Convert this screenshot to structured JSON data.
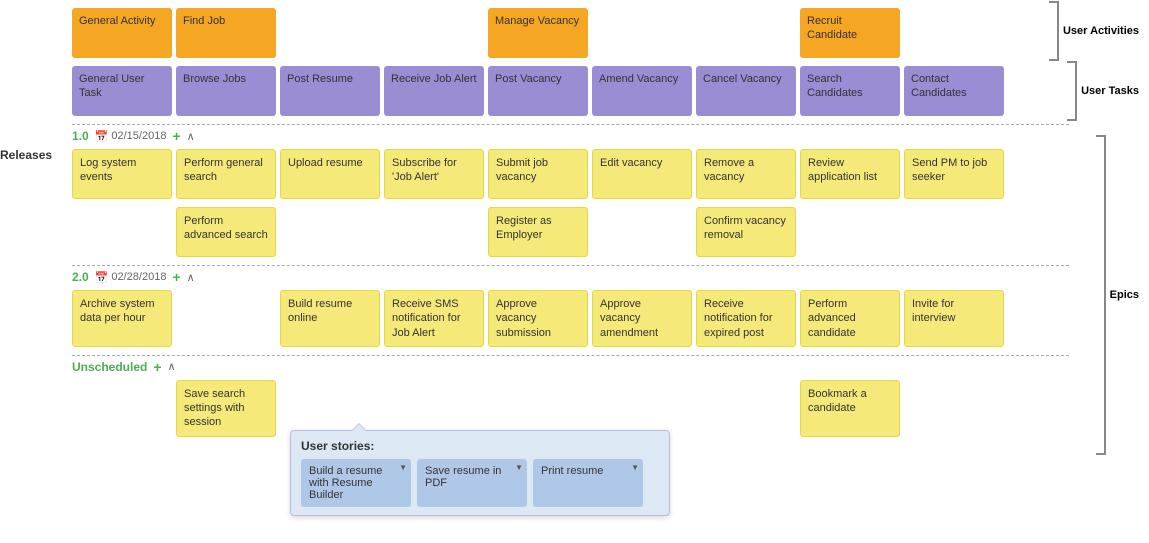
{
  "rightLabels": {
    "userActivities": "User Activities",
    "userTasks": "User Tasks",
    "epics": "Epics"
  },
  "leftLabels": {
    "releases": "Releases"
  },
  "userActivities": [
    {
      "label": "General Activity",
      "color": "orange"
    },
    {
      "label": "Find Job",
      "color": "orange"
    },
    {
      "label": "",
      "color": "empty"
    },
    {
      "label": "",
      "color": "empty"
    },
    {
      "label": "Manage Vacancy",
      "color": "orange"
    },
    {
      "label": "",
      "color": "empty"
    },
    {
      "label": "",
      "color": "empty"
    },
    {
      "label": "Recruit Candidate",
      "color": "orange"
    },
    {
      "label": "",
      "color": "empty"
    }
  ],
  "userTasks": [
    {
      "label": "General User Task",
      "color": "purple"
    },
    {
      "label": "Browse Jobs",
      "color": "purple"
    },
    {
      "label": "Post Resume",
      "color": "purple"
    },
    {
      "label": "Receive Job Alert",
      "color": "purple"
    },
    {
      "label": "Post Vacancy",
      "color": "purple"
    },
    {
      "label": "Amend Vacancy",
      "color": "purple"
    },
    {
      "label": "Cancel Vacancy",
      "color": "purple"
    },
    {
      "label": "Search Candidates",
      "color": "purple"
    },
    {
      "label": "Contact Candidates",
      "color": "purple"
    }
  ],
  "releases": [
    {
      "version": "1.0",
      "date": "02/15/2018",
      "rows": [
        [
          {
            "label": "Log system events",
            "color": "yellow"
          },
          {
            "label": "Perform general search",
            "color": "yellow"
          },
          {
            "label": "Upload resume",
            "color": "yellow"
          },
          {
            "label": "Subscribe for 'Job Alert'",
            "color": "yellow"
          },
          {
            "label": "Submit job vacancy",
            "color": "yellow"
          },
          {
            "label": "Edit vacancy",
            "color": "yellow"
          },
          {
            "label": "Remove a vacancy",
            "color": "yellow"
          },
          {
            "label": "Review application list",
            "color": "yellow"
          },
          {
            "label": "Send PM to job seeker",
            "color": "yellow"
          }
        ],
        [
          {
            "label": "",
            "color": "empty"
          },
          {
            "label": "Perform advanced search",
            "color": "yellow"
          },
          {
            "label": "",
            "color": "empty"
          },
          {
            "label": "",
            "color": "empty"
          },
          {
            "label": "Register as Employer",
            "color": "yellow"
          },
          {
            "label": "",
            "color": "empty"
          },
          {
            "label": "Confirm vacancy removal",
            "color": "yellow"
          },
          {
            "label": "",
            "color": "empty"
          },
          {
            "label": "",
            "color": "empty"
          }
        ]
      ]
    },
    {
      "version": "2.0",
      "date": "02/28/2018",
      "rows": [
        [
          {
            "label": "Archive system data per hour",
            "color": "yellow"
          },
          {
            "label": "",
            "color": "empty"
          },
          {
            "label": "Build resume online",
            "color": "yellow"
          },
          {
            "label": "Receive SMS notification for Job Alert",
            "color": "yellow"
          },
          {
            "label": "Approve vacancy submission",
            "color": "yellow"
          },
          {
            "label": "Approve vacancy amendment",
            "color": "yellow"
          },
          {
            "label": "Receive notification for expired post",
            "color": "yellow"
          },
          {
            "label": "Perform advanced candidate",
            "color": "yellow"
          },
          {
            "label": "Invite for interview",
            "color": "yellow"
          }
        ]
      ]
    }
  ],
  "unscheduled": {
    "label": "Unscheduled",
    "rows": [
      [
        {
          "label": "",
          "color": "empty"
        },
        {
          "label": "Save search settings with session",
          "color": "yellow"
        },
        {
          "label": "",
          "color": "empty"
        },
        {
          "label": "",
          "color": "empty"
        },
        {
          "label": "",
          "color": "empty"
        },
        {
          "label": "",
          "color": "empty"
        },
        {
          "label": "",
          "color": "empty"
        },
        {
          "label": "Bookmark a candidate",
          "color": "yellow"
        },
        {
          "label": "",
          "color": "empty"
        }
      ]
    ]
  },
  "tooltip": {
    "title": "User stories:",
    "cards": [
      {
        "label": "Build a resume with Resume Builder",
        "hasDropdown": true
      },
      {
        "label": "Save resume in PDF",
        "hasDropdown": true
      },
      {
        "label": "Print resume",
        "hasDropdown": true
      }
    ]
  },
  "icons": {
    "calendar": "📅",
    "plus": "+",
    "chevronUp": "∧"
  }
}
